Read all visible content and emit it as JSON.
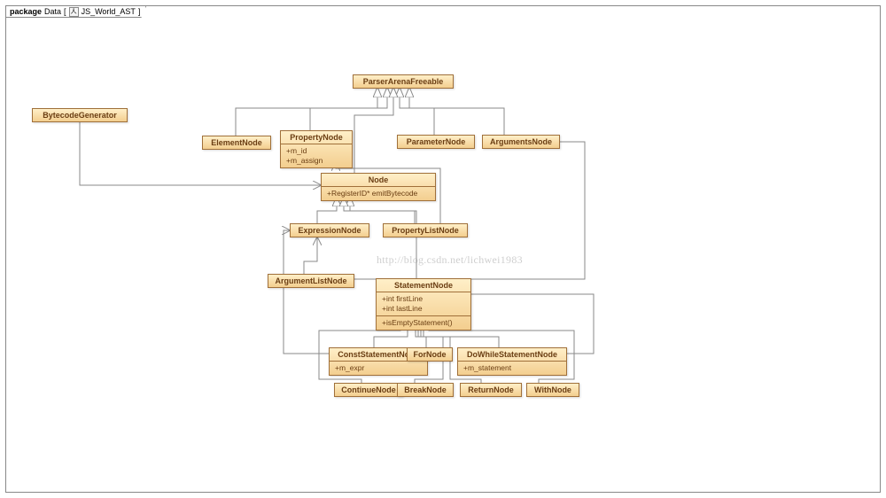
{
  "package": {
    "keyword": "package",
    "name": "Data",
    "icon_glyph": "人",
    "tab_label": "JS_World_AST"
  },
  "watermark": "http://blog.csdn.net/lichwei1983",
  "nodes": {
    "BytecodeGenerator": {
      "title": "BytecodeGenerator"
    },
    "ParserArenaFreeable": {
      "title": "ParserArenaFreeable"
    },
    "ElementNode": {
      "title": "ElementNode"
    },
    "PropertyNode": {
      "title": "PropertyNode",
      "attrs": [
        "+m_id",
        "+m_assign"
      ]
    },
    "ParameterNode": {
      "title": "ParameterNode"
    },
    "ArgumentsNode": {
      "title": "ArgumentsNode"
    },
    "Node": {
      "title": "Node",
      "ops": [
        "+RegisterID* emitBytecode"
      ]
    },
    "ExpressionNode": {
      "title": "ExpressionNode"
    },
    "PropertyListNode": {
      "title": "PropertyListNode"
    },
    "ArgumentListNode": {
      "title": "ArgumentListNode"
    },
    "StatementNode": {
      "title": "StatementNode",
      "attrs": [
        "+int firstLine",
        "+int lastLine"
      ],
      "ops": [
        "+isEmptyStatement()"
      ]
    },
    "ConstStatementNode": {
      "title": "ConstStatementNode",
      "attrs": [
        "+m_expr"
      ]
    },
    "ForNode": {
      "title": "ForNode"
    },
    "DoWhileStatementNode": {
      "title": "DoWhileStatementNode",
      "attrs": [
        "+m_statement"
      ]
    },
    "ContinueNode": {
      "title": "ContinueNode"
    },
    "BreakNode": {
      "title": "BreakNode"
    },
    "ReturnNode": {
      "title": "ReturnNode"
    },
    "WithNode": {
      "title": "WithNode"
    }
  }
}
